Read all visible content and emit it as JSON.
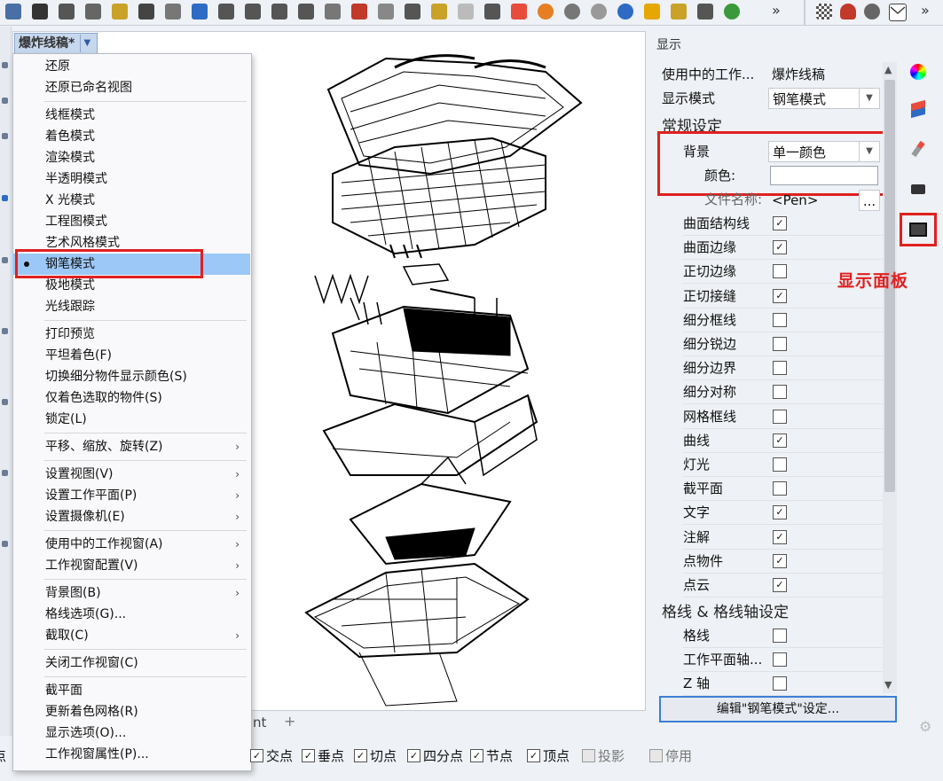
{
  "toolbar": {
    "icons": [
      "save-icon",
      "print-icon",
      "copy-icon",
      "cut-icon",
      "paste-icon",
      "undo-icon",
      "pan-icon",
      "rotate-icon",
      "zoom-icon",
      "zoom-window-icon",
      "zoom-extents-icon",
      "zoom-selected-icon",
      "grid-icon",
      "car-icon",
      "eye-icon",
      "target-icon",
      "snap-icon",
      "bulb-icon",
      "lock-icon",
      "layer-icon",
      "color-wheel-icon",
      "sphere-icon",
      "sphere-icon",
      "globe-icon",
      "cursor-icon",
      "gear-icon",
      "transform-icon",
      "green-globe-icon"
    ],
    "overflow_label": "»",
    "right_icons": [
      "checker-icon",
      "cloud-icon",
      "gear-icon",
      "mail-icon"
    ]
  },
  "viewport": {
    "title": "爆炸线稿*",
    "tab_text": "nt",
    "tab_add": "+"
  },
  "menu": {
    "items": [
      {
        "label": "还原"
      },
      {
        "label": "还原已命名视图"
      },
      {
        "label": "线框模式"
      },
      {
        "label": "着色模式"
      },
      {
        "label": "渲染模式"
      },
      {
        "label": "半透明模式"
      },
      {
        "label": "X 光模式"
      },
      {
        "label": "工程图模式"
      },
      {
        "label": "艺术风格模式"
      },
      {
        "label": "钢笔模式"
      },
      {
        "label": "极地模式"
      },
      {
        "label": "光线跟踪"
      },
      {
        "label": "打印预览"
      },
      {
        "label": "平坦着色(F)"
      },
      {
        "label": "切换细分物件显示颜色(S)"
      },
      {
        "label": "仅着色选取的物件(S)"
      },
      {
        "label": "锁定(L)"
      },
      {
        "label": "平移、缩放、旋转(Z)"
      },
      {
        "label": "设置视图(V)"
      },
      {
        "label": "设置工作平面(P)"
      },
      {
        "label": "设置摄像机(E)"
      },
      {
        "label": "使用中的工作视窗(A)"
      },
      {
        "label": "工作视窗配置(V)"
      },
      {
        "label": "背景图(B)"
      },
      {
        "label": "格线选项(G)..."
      },
      {
        "label": "截取(C)"
      },
      {
        "label": "关闭工作视窗(C)"
      },
      {
        "label": "截平面"
      },
      {
        "label": "更新着色网格(R)"
      },
      {
        "label": "显示选项(O)..."
      },
      {
        "label": "工作视窗属性(P)..."
      }
    ],
    "selected": "钢笔模式",
    "submenu_arrow": "›"
  },
  "osnaps": [
    {
      "label": "点",
      "checked": true
    },
    {
      "label": "交点",
      "checked": true
    },
    {
      "label": "垂点",
      "checked": true
    },
    {
      "label": "切点",
      "checked": true
    },
    {
      "label": "四分点",
      "checked": true
    },
    {
      "label": "节点",
      "checked": true
    },
    {
      "label": "顶点",
      "checked": true
    },
    {
      "label": "投影",
      "checked": false
    },
    {
      "label": "停用",
      "checked": false
    }
  ],
  "panel": {
    "title": "显示",
    "active_viewport_label": "使用中的工作...",
    "active_viewport_value": "爆炸线稿",
    "display_mode_label": "显示模式",
    "display_mode_value": "钢笔模式",
    "general_section": "常规设定",
    "background_label": "背景",
    "background_value": "单一颜色",
    "color_label": "颜色:",
    "color_value": "#ffffff",
    "filename_label": "文件名称:",
    "filename_value": "<Pen>",
    "filename_button": "...",
    "checkboxes": [
      {
        "label": "曲面结构线",
        "checked": true
      },
      {
        "label": "曲面边缘",
        "checked": true
      },
      {
        "label": "正切边缘",
        "checked": false
      },
      {
        "label": "正切接缝",
        "checked": true
      },
      {
        "label": "细分框线",
        "checked": false
      },
      {
        "label": "细分锐边",
        "checked": false
      },
      {
        "label": "细分边界",
        "checked": false
      },
      {
        "label": "细分对称",
        "checked": false
      },
      {
        "label": "网格框线",
        "checked": false
      },
      {
        "label": "曲线",
        "checked": true
      },
      {
        "label": "灯光",
        "checked": false
      },
      {
        "label": "截平面",
        "checked": false
      },
      {
        "label": "文字",
        "checked": true
      },
      {
        "label": "注解",
        "checked": true
      },
      {
        "label": "点物件",
        "checked": true
      },
      {
        "label": "点云",
        "checked": true
      }
    ],
    "grid_section": "格线 & 格线轴设定",
    "grid_checkboxes": [
      {
        "label": "格线",
        "checked": false
      },
      {
        "label": "工作平面轴...",
        "checked": false
      },
      {
        "label": "Z 轴",
        "checked": false
      }
    ],
    "edit_button": "编辑\"钢笔模式\"设定..."
  },
  "right_strip": {
    "icons": [
      "color-wheel-icon",
      "layers-icon",
      "brush-icon",
      "camera-icon",
      "display-icon"
    ]
  },
  "annotation": "显示面板",
  "check_mark": "✓",
  "colors": {
    "highlight_red": "#e02020",
    "selection_blue": "#9cc8f7"
  }
}
